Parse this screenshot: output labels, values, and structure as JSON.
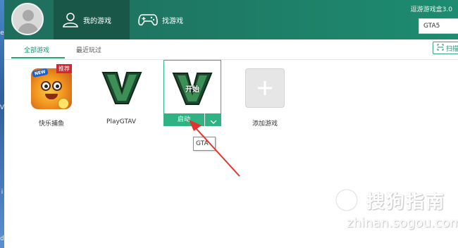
{
  "header": {
    "tabs": [
      {
        "label": "我的游戏",
        "active": true,
        "icon": "user-icon"
      },
      {
        "label": "找游戏",
        "active": false,
        "icon": "gamepad-icon"
      }
    ],
    "version": "逗游游戏盒3.0",
    "search": {
      "value": "GTA5"
    }
  },
  "subtabs": {
    "items": [
      {
        "label": "全部游戏",
        "active": true
      },
      {
        "label": "最近玩过",
        "active": false
      }
    ],
    "scan_label": "扫描"
  },
  "games": [
    {
      "label": "快乐捕鱼",
      "badge_new": "NEW",
      "badge_recommend": "推荐",
      "icon": "fish-game-icon"
    },
    {
      "label": "PlayGTAV",
      "icon": "gtav-v-logo"
    },
    {
      "overlay_label": "开始",
      "launch_label": "启动",
      "icon": "gtav-v-logo",
      "hovered": true
    },
    {
      "label": "添加游戏",
      "icon": "plus-icon"
    }
  ],
  "tooltip": {
    "text": "GTA"
  },
  "watermark": {
    "text_cn": "搜狗指南",
    "text_en": "zhinan.sogou.com"
  },
  "desktop_edge": {
    "letters": [
      "e",
      "V",
      "i",
      "d"
    ]
  },
  "colors": {
    "header_green": "#1e7a64",
    "accent_green": "#2fb382",
    "badge_red": "#d8252f",
    "annotation_red": "#e5322d"
  }
}
